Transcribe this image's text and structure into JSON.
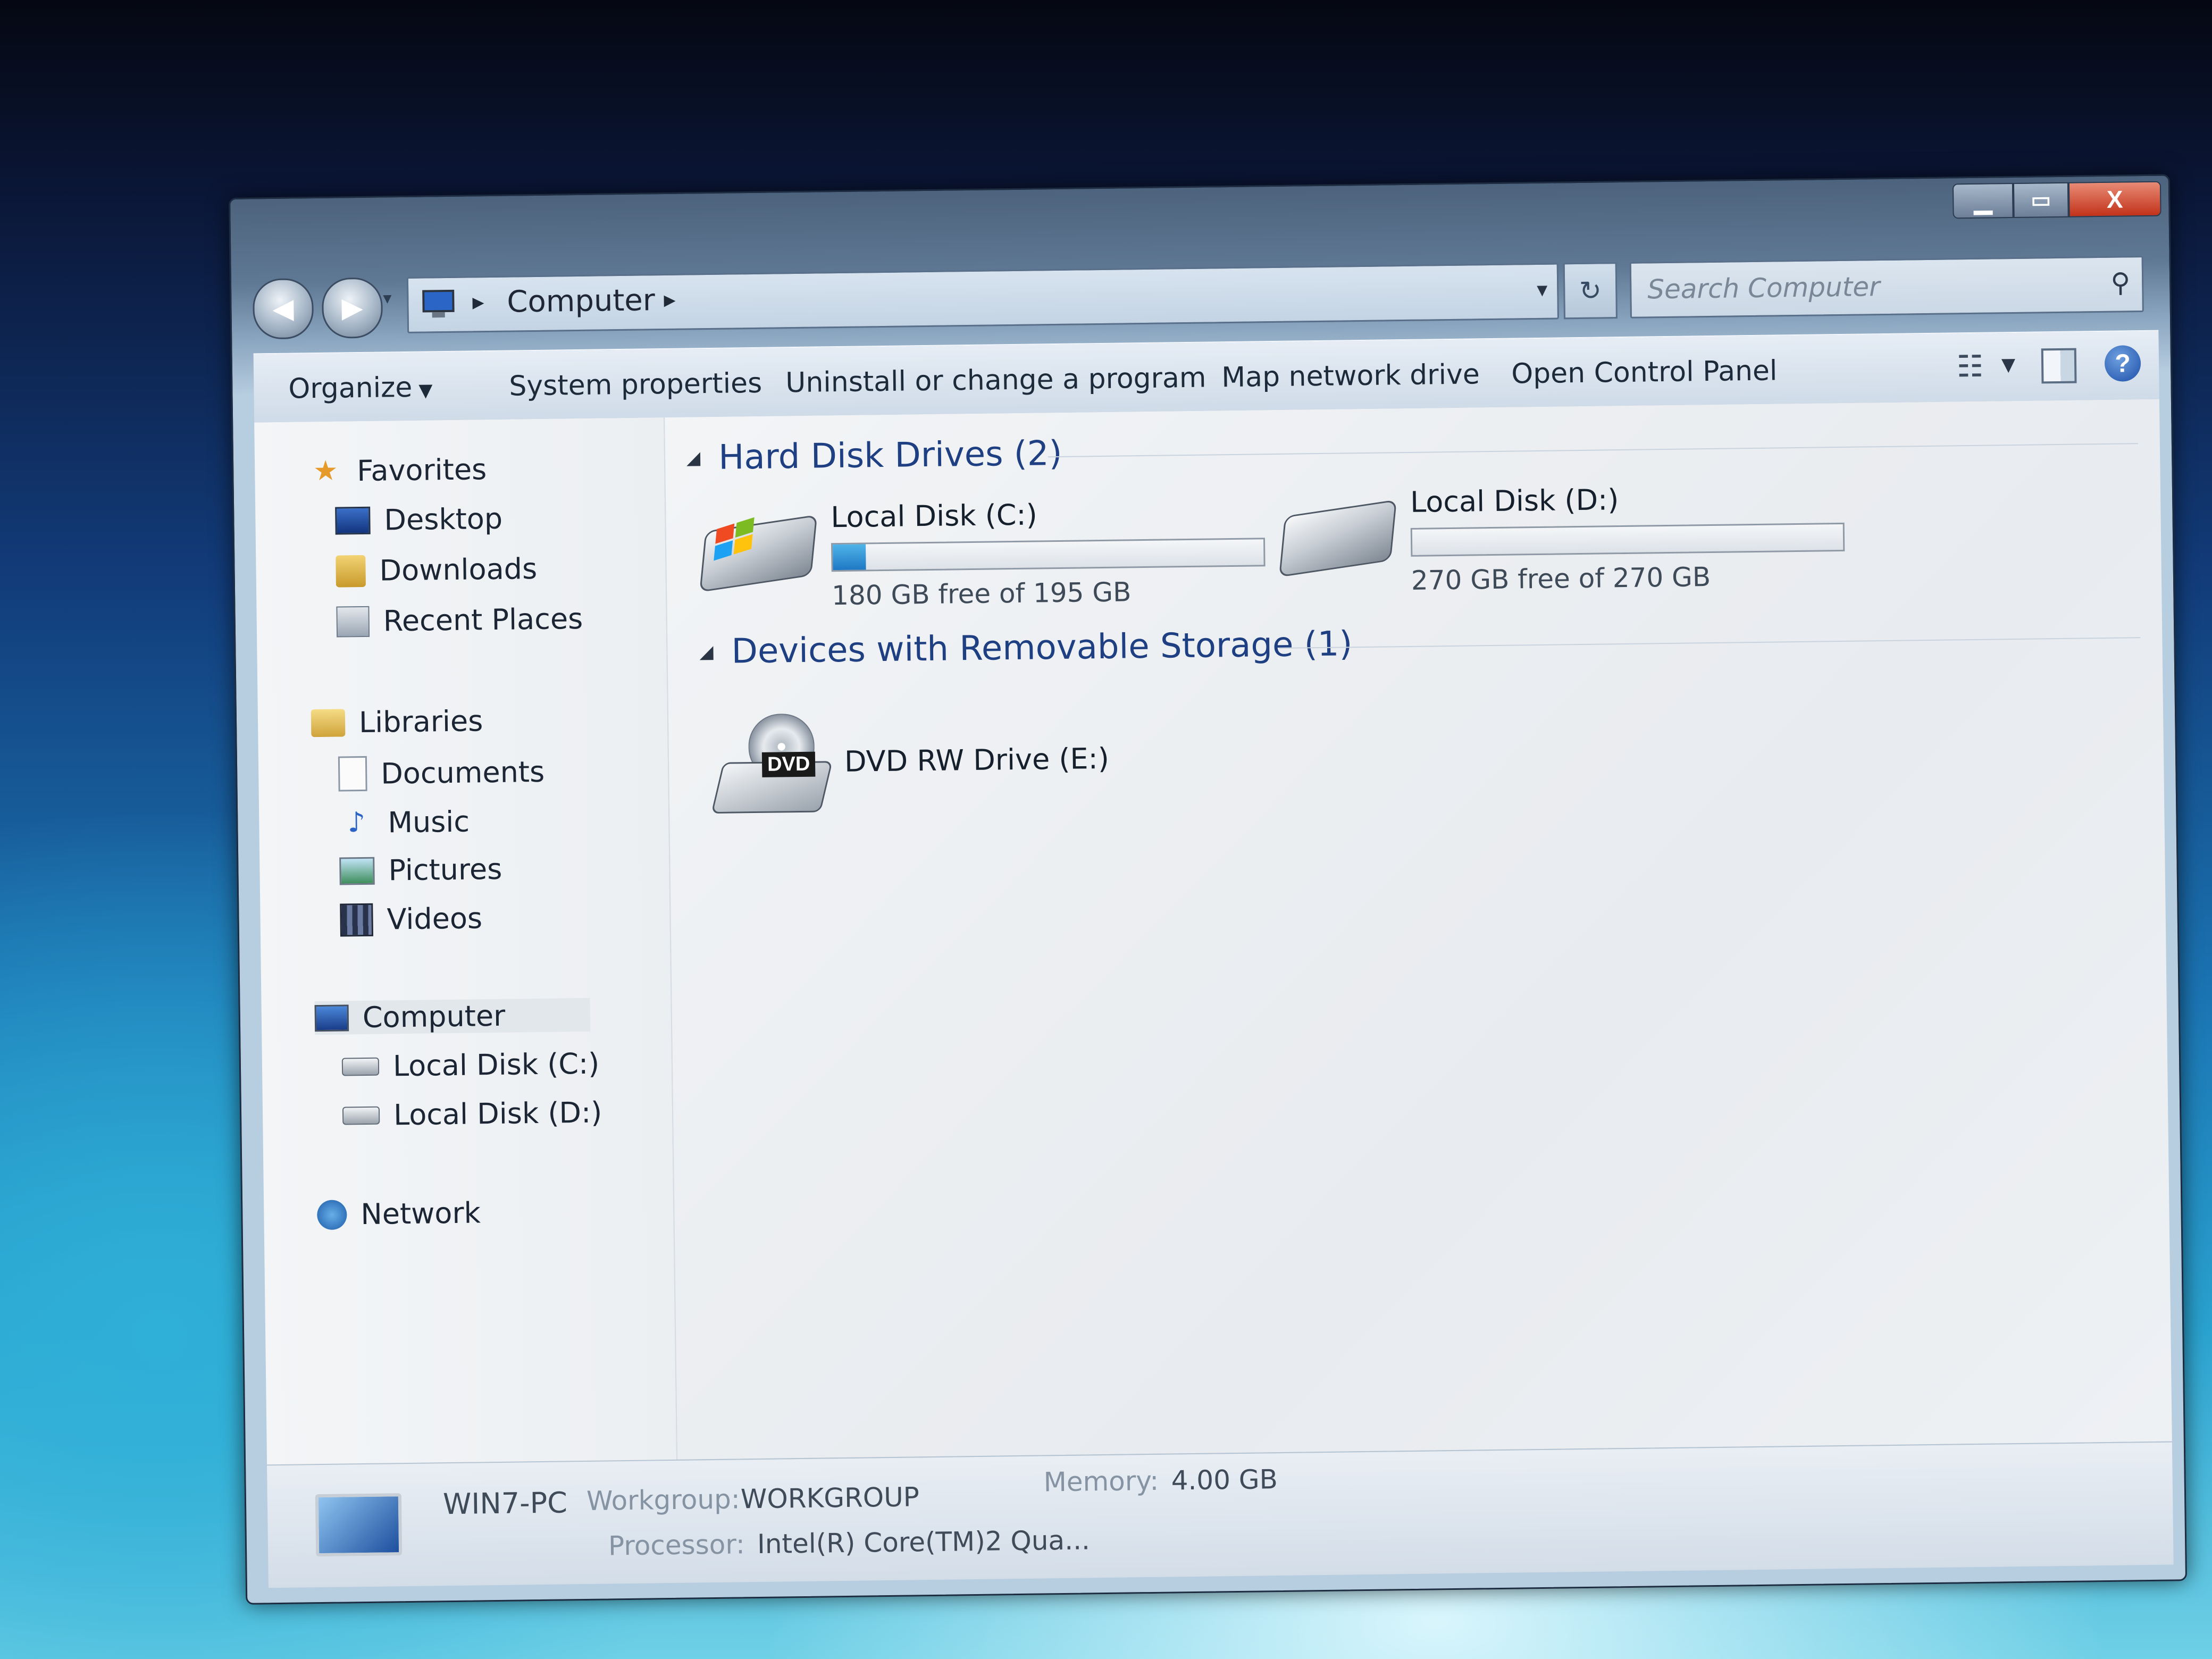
{
  "window": {
    "caption_buttons": {
      "minimize": "▁",
      "maximize": "▭",
      "close": "X"
    }
  },
  "navigation": {
    "back_icon": "◀",
    "forward_icon": "▶",
    "history_dropdown": "▾",
    "breadcrumb": [
      "Computer"
    ],
    "breadcrumb_separator": "▸",
    "address_dropdown": "▾",
    "refresh_icon": "↻",
    "search_placeholder": "Search Computer",
    "search_icon": "⚲"
  },
  "command_bar": {
    "organize": "Organize",
    "organize_caret": "▼",
    "system_properties": "System properties",
    "uninstall": "Uninstall or change a program",
    "map_network_drive": "Map network drive",
    "open_control_panel": "Open Control Panel",
    "views_icon": "☷",
    "views_caret": "▼",
    "help_icon": "?"
  },
  "nav_pane": {
    "favorites": {
      "label": "Favorites",
      "icon": "★",
      "items": [
        "Desktop",
        "Downloads",
        "Recent Places"
      ]
    },
    "libraries": {
      "label": "Libraries",
      "items": [
        "Documents",
        "Music",
        "Pictures",
        "Videos"
      ],
      "music_icon": "♪"
    },
    "computer": {
      "label": "Computer",
      "items": [
        "Local Disk (C:)",
        "Local Disk (D:)"
      ]
    },
    "network": {
      "label": "Network"
    }
  },
  "content": {
    "hard_disk_group": {
      "label": "Hard Disk Drives (2)",
      "toggle": "◢"
    },
    "drives": [
      {
        "name": "Local Disk (C:)",
        "free_text": "180 GB free of 195 GB",
        "used_fraction": 0.077
      },
      {
        "name": "Local Disk (D:)",
        "free_text": "270 GB free of 270 GB",
        "used_fraction": 0.0
      }
    ],
    "removable_group": {
      "label": "Devices with Removable Storage (1)",
      "toggle": "◢"
    },
    "removable": [
      {
        "name": "DVD RW Drive (E:)",
        "badge": "DVD"
      }
    ]
  },
  "details": {
    "computer_name": "WIN7-PC",
    "workgroup_label": "Workgroup:",
    "workgroup_value": "WORKGROUP",
    "memory_label": "Memory:",
    "memory_value": "4.00 GB",
    "processor_label": "Processor:",
    "processor_value": "Intel(R) Core(TM)2 Qua..."
  },
  "colors": {
    "group_header": "#1e3f82",
    "usage_bar": "#1f78c4",
    "close_button": "#c2321a"
  }
}
